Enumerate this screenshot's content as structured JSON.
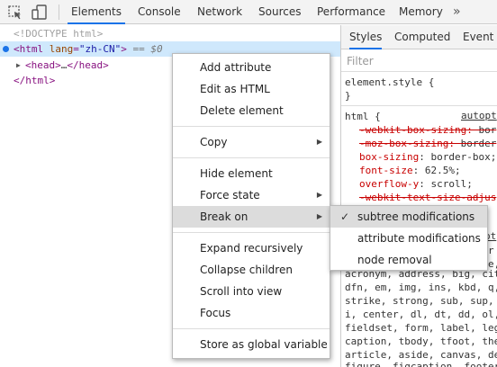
{
  "toolbar": {
    "inspect_icon": "inspect-element-icon",
    "device_icon": "device-toolbar-icon",
    "tabs": [
      "Elements",
      "Console",
      "Network",
      "Sources",
      "Performance",
      "Memory"
    ],
    "more": "»"
  },
  "tree": {
    "doctype": "<!DOCTYPE html>",
    "html_open": "<html",
    "html_attr_name": "lang",
    "html_attr_eq": "=",
    "html_attr_val": "\"zh-CN\"",
    "html_close_bracket": ">",
    "html_suffix": "== $0",
    "head": "<head>",
    "head_ellipsis": "…",
    "head_close": "</head>",
    "html_end": "</html>"
  },
  "side": {
    "tabs": [
      "Styles",
      "Computed",
      "Event L"
    ],
    "filter_placeholder": "Filter",
    "element_style": "element.style {",
    "element_style_close": "}",
    "html_selector": "html {",
    "source_link": "autopt",
    "props": [
      {
        "name": "-webkit-box-sizing",
        "value": "bor",
        "struck": true
      },
      {
        "name": "-moz-box-sizing",
        "value": "border",
        "struck": true
      },
      {
        "name": "box-sizing",
        "value": "border-box;",
        "struck": false
      },
      {
        "name": "font-size",
        "value": "62.5%;",
        "struck": false
      },
      {
        "name": "overflow-y",
        "value": "scroll;",
        "struck": false
      },
      {
        "name": "-webkit-text-size-adjus",
        "value": "",
        "struck": true
      }
    ],
    "lower_link": "ot",
    "lower_lines": [
      "r",
      "e,",
      "acronym, address, big, cit",
      "dfn, em, img, ins, kbd, q,",
      "strike, strong, sub, sup,",
      "i, center, dl, dt, dd, ol,",
      "fieldset, form, label, leg",
      "caption, tbody, tfoot, the",
      "article, aside, canvas, de",
      "figure, figcaption, footer"
    ]
  },
  "context_menu": {
    "items": [
      "Add attribute",
      "Edit as HTML",
      "Delete element",
      "Copy",
      "Hide element",
      "Force state",
      "Break on",
      "Expand recursively",
      "Collapse children",
      "Scroll into view",
      "Focus",
      "Store as global variable"
    ],
    "arrow": "▶"
  },
  "submenu": {
    "check": "✓",
    "items": [
      "subtree modifications",
      "attribute modifications",
      "node removal"
    ]
  }
}
